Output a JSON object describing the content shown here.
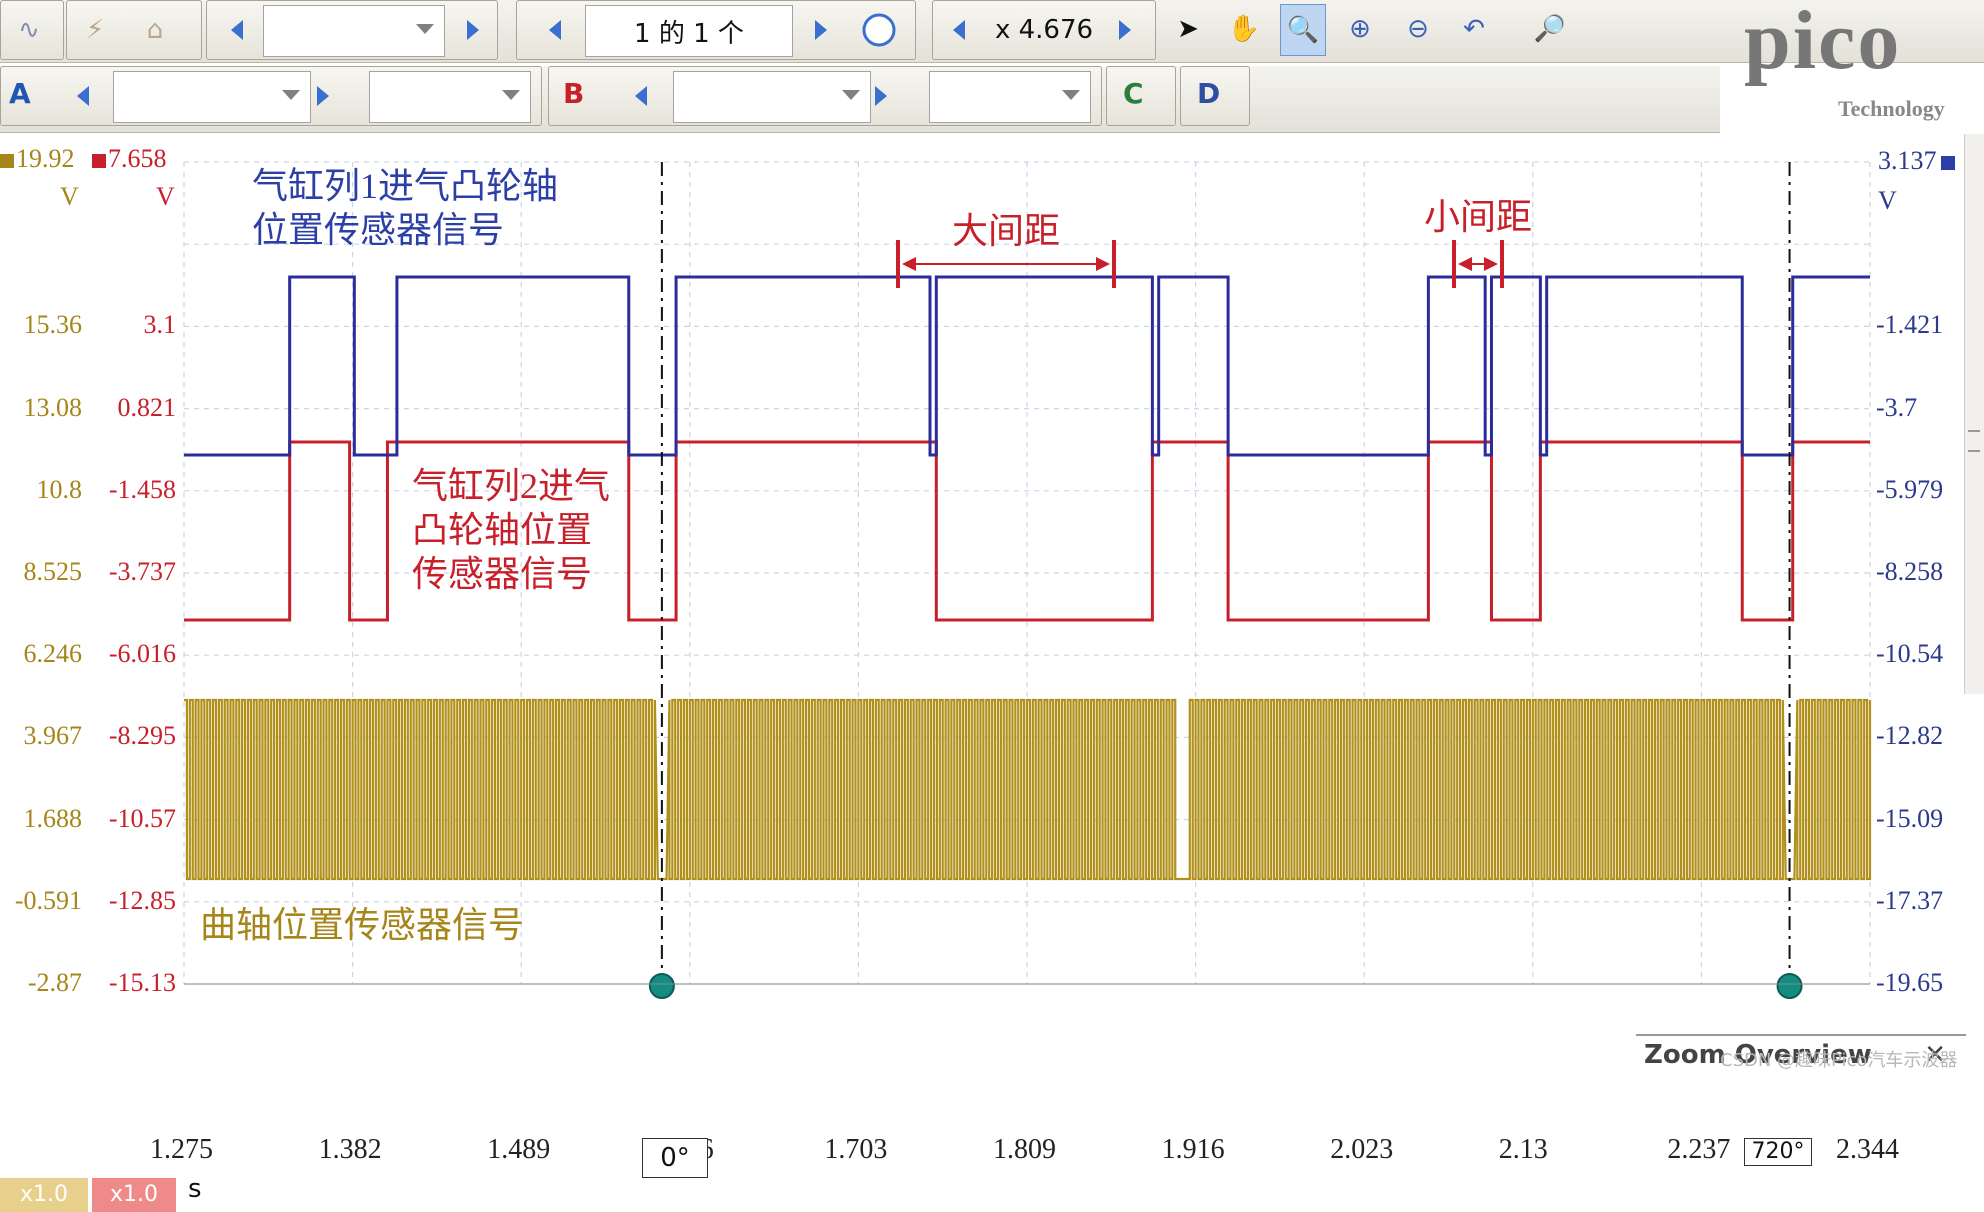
{
  "toolbar1": {
    "page_indicator": "1 的 1 个",
    "zoom_value": "x 4.676",
    "brand_logo": "pico",
    "brand_sub": "Technology",
    "capture_dropdown": ""
  },
  "toolbar2": {
    "channels": [
      {
        "name": "A",
        "color": "#1f56b0"
      },
      {
        "name": "B",
        "color": "#c8202a"
      },
      {
        "name": "C",
        "color": "#2e7d3a"
      },
      {
        "name": "D",
        "color": "#2e4ea0"
      }
    ]
  },
  "colors": {
    "blue_trace": "#2b2d9c",
    "red_trace": "#c8202a",
    "yellow_trace": "#b0901a",
    "left_axis_a": "#a6861a",
    "left_axis_b": "#c8202a",
    "right_axis": "#2a3a8c",
    "annotation_red": "#c8202a"
  },
  "axes": {
    "left_a_top": "19.92",
    "left_b_top": "7.658",
    "left_a_unit": "V",
    "left_b_unit": "V",
    "left_a_ticks": [
      "15.36",
      "13.08",
      "10.8",
      "8.525",
      "6.246",
      "3.967",
      "1.688",
      "-0.591",
      "-2.87"
    ],
    "left_b_ticks": [
      "3.1",
      "0.821",
      "-1.458",
      "-3.737",
      "-6.016",
      "-8.295",
      "-10.57",
      "-12.85",
      "-15.13"
    ],
    "right_top": "3.137",
    "right_unit": "V",
    "right_ticks": [
      "-1.421",
      "-3.7",
      "-5.979",
      "-8.258",
      "-10.54",
      "-12.82",
      "-15.09",
      "-17.37",
      "-19.65"
    ],
    "x_ticks": [
      "1.275",
      "1.382",
      "1.489",
      "6",
      "1.703",
      "1.809",
      "1.916",
      "2.023",
      "2.13",
      "2.237",
      "2.344"
    ],
    "x_unit": "s",
    "scale_a": "x1.0",
    "scale_b": "x1.0"
  },
  "annotations": {
    "bank1_line1": "气缸列1进气凸轮轴",
    "bank1_line2": "位置传感器信号",
    "bank2_line1": "气缸列2进气",
    "bank2_line2": "凸轮轴位置",
    "bank2_line3": "传感器信号",
    "crank": "曲轴位置传感器信号",
    "big_gap": "大间距",
    "small_gap": "小间距",
    "marker_0": "0°",
    "marker_720": "720°",
    "zoom_overview": "Zoom Overview",
    "watermark": "CSDN @趣味Pico汽车示波器"
  },
  "chart_data": {
    "type": "line",
    "x_range": [
      1.275,
      2.344
    ],
    "xlabel": "s",
    "series": [
      {
        "name": "气缸列1进气凸轮轴位置传感器信号",
        "color": "#2b2d9c",
        "edges_s": [
          1.342,
          1.383,
          1.41,
          1.557,
          1.587,
          1.748,
          1.752,
          1.889,
          1.893,
          1.937,
          2.064,
          2.1,
          2.104,
          2.135,
          2.139,
          2.263,
          2.295
        ]
      },
      {
        "name": "气缸列2进气凸轮轴位置传感器信号",
        "color": "#c8202a",
        "edges_s": [
          1.342,
          1.38,
          1.404,
          1.557,
          1.587,
          1.752,
          1.889,
          1.937,
          2.064,
          2.104,
          2.135,
          2.263,
          2.295
        ]
      },
      {
        "name": "曲轴位置传感器信号",
        "color": "#b0901a",
        "pattern": "pulse train with missing teeth near 1.580 s, 1.910 s, 2.293 s"
      }
    ],
    "markers": [
      {
        "label": "0°",
        "x": 1.578
      },
      {
        "label": "720°",
        "x": 2.293
      }
    ]
  }
}
